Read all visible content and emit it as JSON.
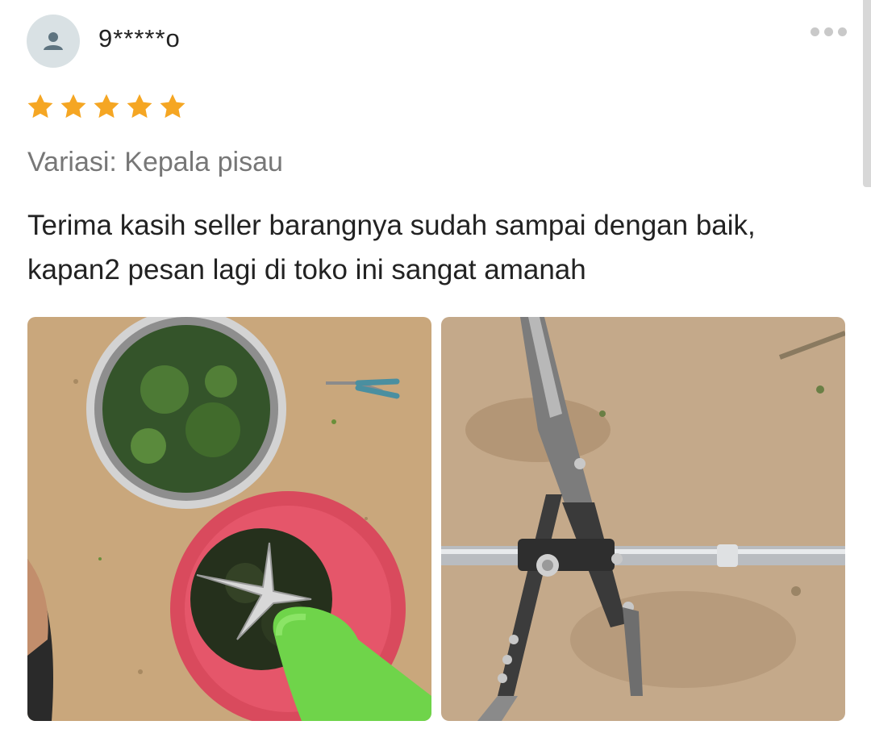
{
  "review": {
    "user": {
      "name": "9*****o",
      "avatar_icon": "person-icon"
    },
    "menu_icon": "more-horizontal-icon",
    "rating": 5,
    "rating_max": 5,
    "star_color": "#f5a623",
    "variant": "Variasi: Kepala pisau",
    "text": "Terima kasih seller barangnya sudah sampai dengan baik, kapan2 pesan lagi di toko ini sangat amanah",
    "photos": [
      {
        "name": "review-photo-1"
      },
      {
        "name": "review-photo-2"
      }
    ]
  }
}
